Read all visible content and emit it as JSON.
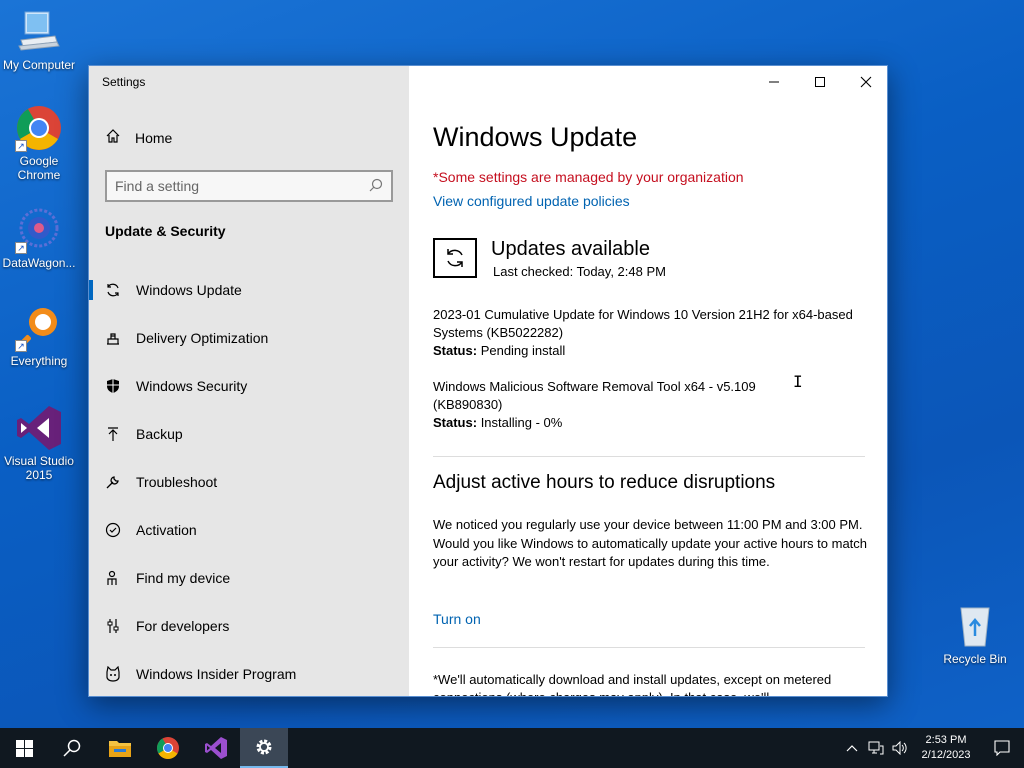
{
  "desktop": {
    "icons": [
      {
        "label": "My Computer"
      },
      {
        "label": "Google Chrome"
      },
      {
        "label": "DataWagon..."
      },
      {
        "label": "Everything"
      },
      {
        "label": "Visual Studio 2015"
      },
      {
        "label": "Recycle Bin"
      }
    ]
  },
  "window": {
    "title": "Settings",
    "sidebar": {
      "home": "Home",
      "search_placeholder": "Find a setting",
      "section": "Update & Security",
      "items": [
        {
          "label": "Windows Update",
          "icon": "sync-icon"
        },
        {
          "label": "Delivery Optimization",
          "icon": "delivery-icon"
        },
        {
          "label": "Windows Security",
          "icon": "shield-icon"
        },
        {
          "label": "Backup",
          "icon": "backup-arrow-icon"
        },
        {
          "label": "Troubleshoot",
          "icon": "wrench-icon"
        },
        {
          "label": "Activation",
          "icon": "check-circle-icon"
        },
        {
          "label": "Find my device",
          "icon": "person-pin-icon"
        },
        {
          "label": "For developers",
          "icon": "sliders-icon"
        },
        {
          "label": "Windows Insider Program",
          "icon": "insider-cat-icon"
        }
      ]
    },
    "main": {
      "title": "Windows Update",
      "org_warning": "*Some settings are managed by your organization",
      "policies_link": "View configured update policies",
      "status_heading": "Updates available",
      "last_checked": "Last checked: Today, 2:48 PM",
      "updates": [
        {
          "name": "2023-01 Cumulative Update for Windows 10 Version 21H2 for x64-based Systems (KB5022282)",
          "status_label": "Status:",
          "status": "Pending install"
        },
        {
          "name": "Windows Malicious Software Removal Tool x64 - v5.109 (KB890830)",
          "status_label": "Status:",
          "status": "Installing - 0%"
        }
      ],
      "active_hours_heading": "Adjust active hours to reduce disruptions",
      "active_hours_text": "We noticed you regularly use your device between 11:00 PM and 3:00 PM. Would you like Windows to automatically update your active hours to match your activity? We won't restart for updates during this time.",
      "turn_on": "Turn on",
      "footnote": "*We'll automatically download and install updates, except on metered connections (where charges may apply). In that case, we'll"
    }
  },
  "taskbar": {
    "time": "2:53 PM",
    "date": "2/12/2023"
  },
  "colors": {
    "accent": "#0067c0",
    "link": "#0063b1",
    "warning": "#c50f1f",
    "taskbar": "#101820"
  }
}
